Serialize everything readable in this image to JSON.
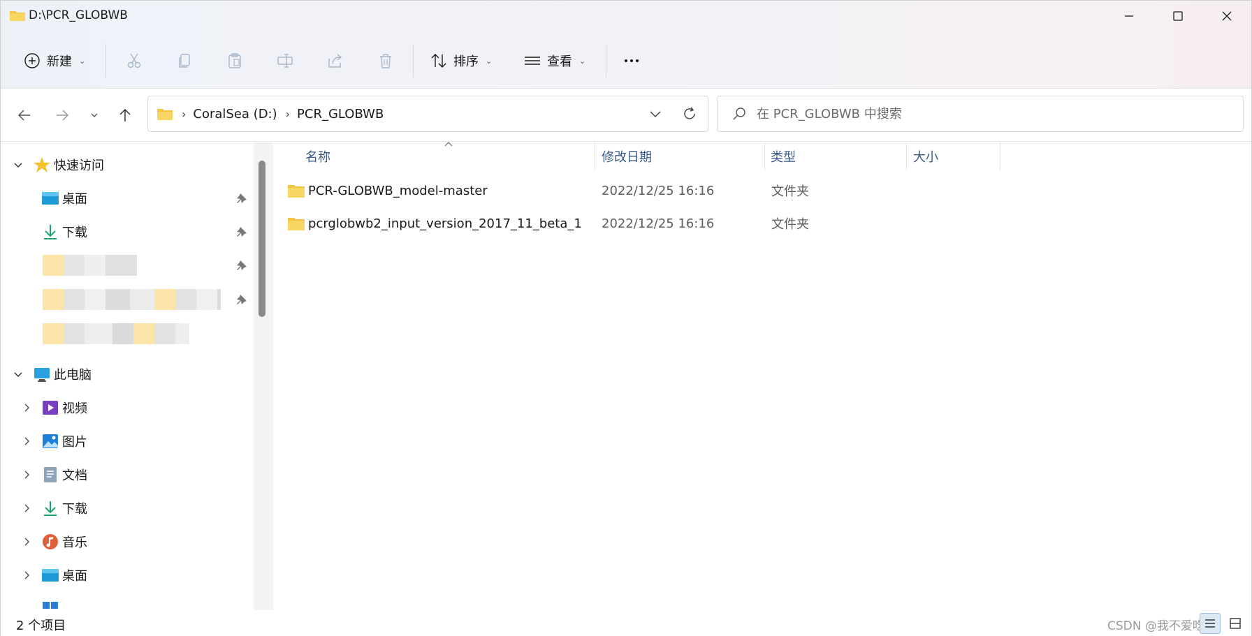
{
  "window": {
    "title": "D:\\PCR_GLOBWB",
    "icon": "folder-icon",
    "controls": [
      "minimize-icon",
      "maximize-icon",
      "close-icon"
    ]
  },
  "toolbar": {
    "new_label": "新建",
    "sort_label": "排序",
    "view_label": "查看",
    "icons": [
      "plus-circle-icon",
      "cut-icon",
      "copy-icon",
      "paste-icon",
      "rename-icon",
      "share-icon",
      "delete-icon",
      "sort-icon",
      "view-list-icon",
      "more-icon"
    ]
  },
  "address": {
    "crumbs": [
      "CoralSea (D:)",
      "PCR_GLOBWB"
    ]
  },
  "search": {
    "placeholder": "在 PCR_GLOBWB 中搜索"
  },
  "sidebar": {
    "quick_access": {
      "label": "快速访问",
      "items": [
        {
          "label": "桌面",
          "icon": "desktop-icon",
          "pinned": true
        },
        {
          "label": "下载",
          "icon": "download-icon",
          "pinned": true
        }
      ]
    },
    "this_pc": {
      "label": "此电脑",
      "items": [
        {
          "label": "视频",
          "icon": "video-icon"
        },
        {
          "label": "图片",
          "icon": "pictures-icon"
        },
        {
          "label": "文档",
          "icon": "documents-icon"
        },
        {
          "label": "下载",
          "icon": "download-icon"
        },
        {
          "label": "音乐",
          "icon": "music-icon"
        },
        {
          "label": "桌面",
          "icon": "desktop-icon"
        }
      ]
    }
  },
  "columns": {
    "name": "名称",
    "modified": "修改日期",
    "type": "类型",
    "size": "大小"
  },
  "files": [
    {
      "name": "PCR-GLOBWB_model-master",
      "modified": "2022/12/25 16:16",
      "type": "文件夹"
    },
    {
      "name": "pcrglobwb2_input_version_2017_11_beta_1",
      "modified": "2022/12/25 16:16",
      "type": "文件夹"
    }
  ],
  "status": {
    "count": "2 个项目",
    "watermark": "CSDN @我不爱吃甜"
  },
  "colors": {
    "folder": "#f4c542",
    "header_text": "#3a5a8a",
    "secondary_text": "#5d5d5d"
  }
}
